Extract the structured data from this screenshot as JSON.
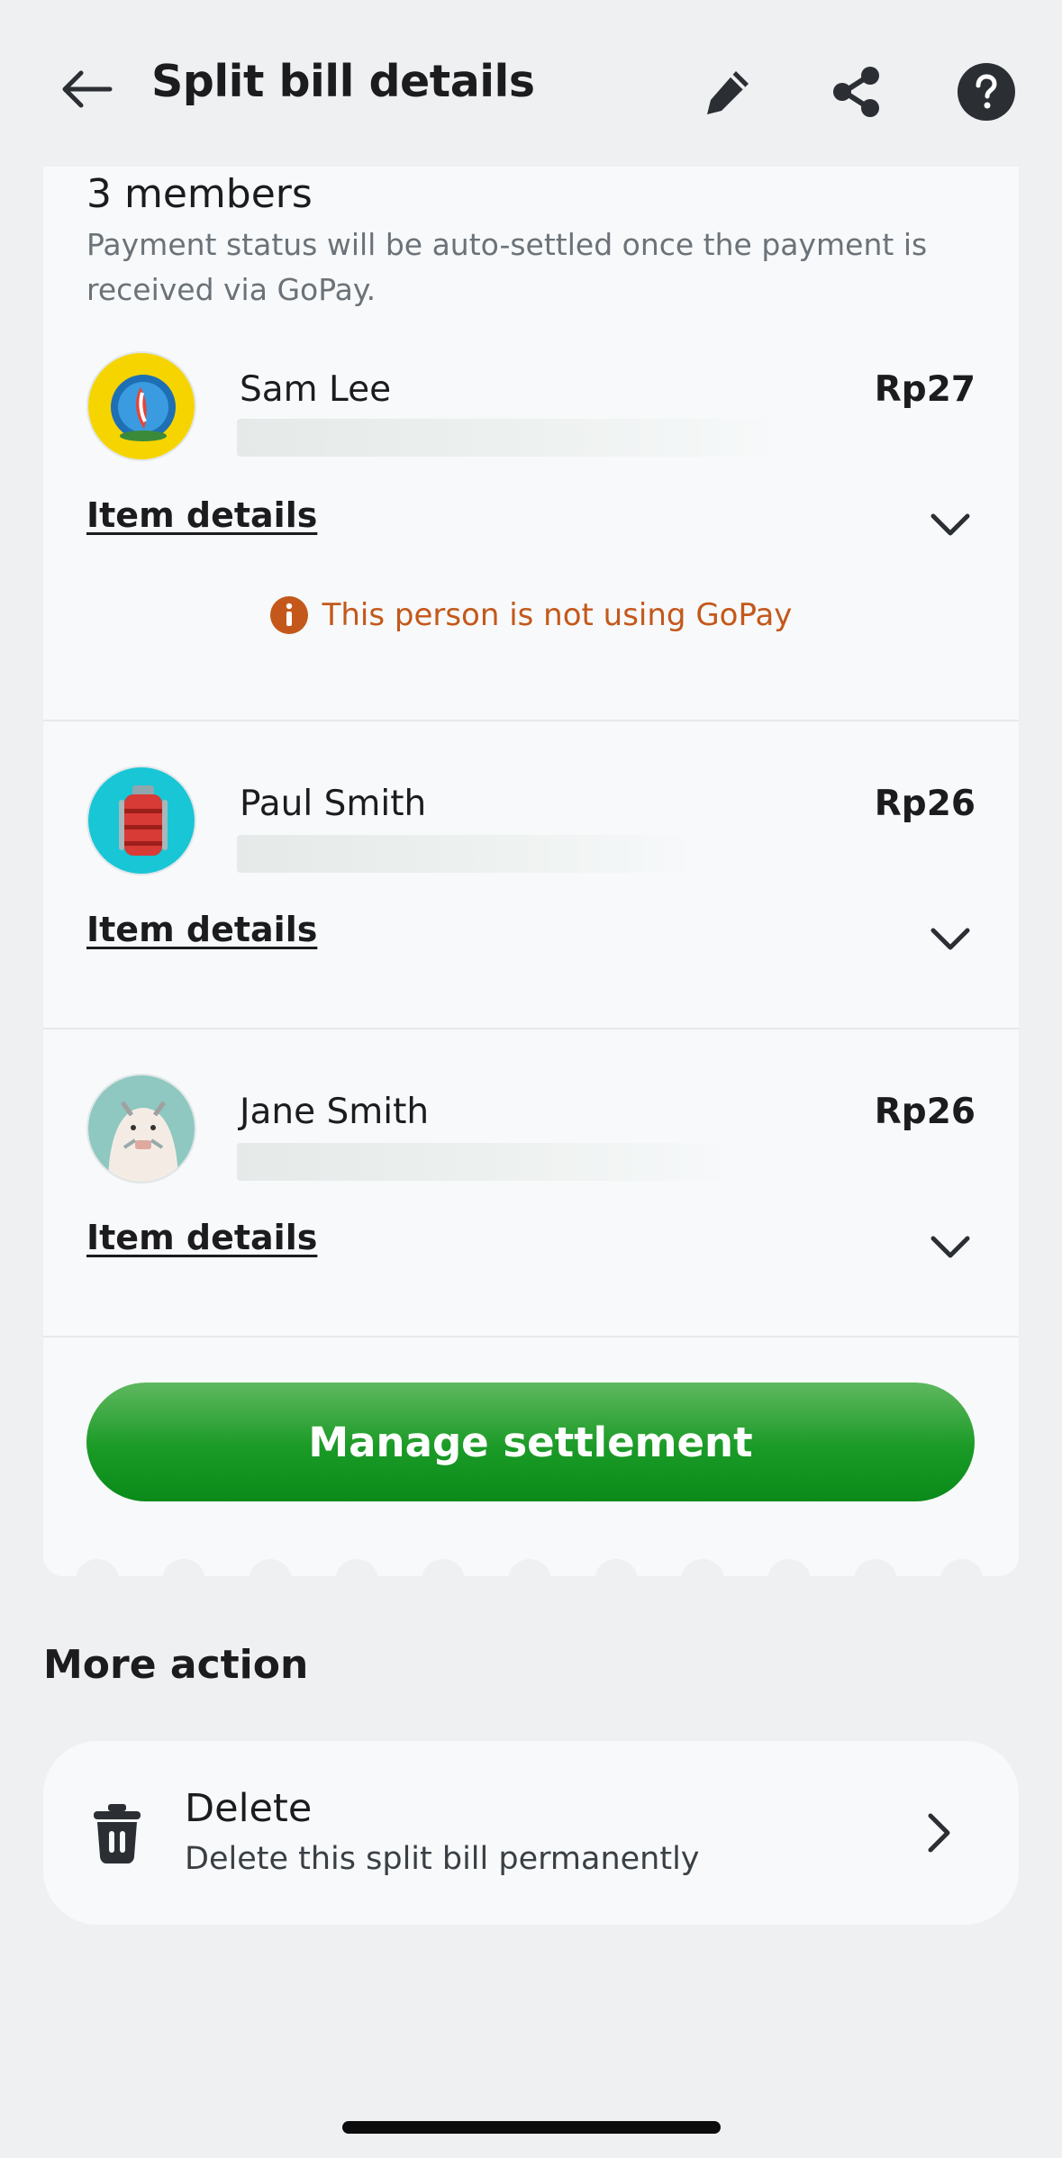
{
  "header": {
    "title": "Split bill details",
    "back_icon": "arrow-left-icon",
    "edit_icon": "pencil-icon",
    "share_icon": "share-icon",
    "help_icon": "question-icon"
  },
  "members": {
    "title": "3 members",
    "subtitle": "Payment status will be auto-settled once the payment is received via GoPay.",
    "item_details_label": "Item details",
    "list": [
      {
        "name": "Sam Lee",
        "amount": "Rp27",
        "notice": "This person is not using GoPay"
      },
      {
        "name": "Paul Smith",
        "amount": "Rp26"
      },
      {
        "name": "Jane Smith",
        "amount": "Rp26"
      }
    ]
  },
  "manage_button": "Manage settlement",
  "more_action": {
    "title": "More action",
    "delete": {
      "title": "Delete",
      "subtitle": "Delete this split bill permanently"
    }
  },
  "colors": {
    "accent_green": "#1a9a26",
    "notice_orange": "#c4581b",
    "background": "#eef0f1",
    "card": "#f7f9fa"
  }
}
